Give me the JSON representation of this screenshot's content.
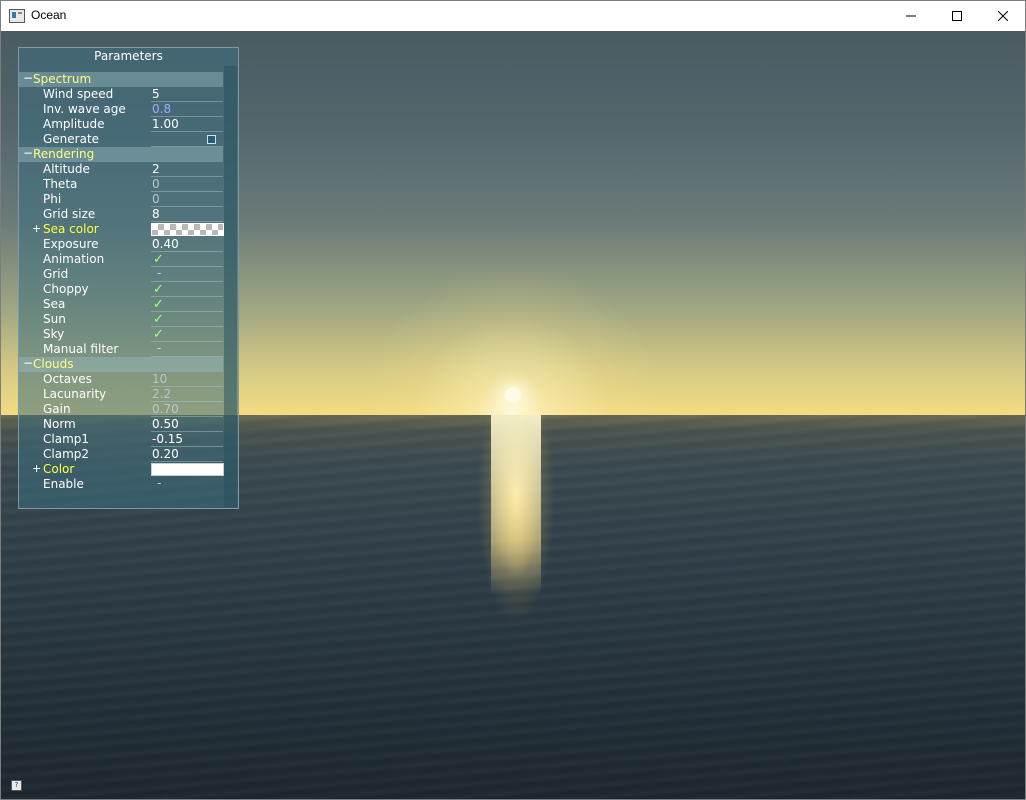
{
  "window": {
    "title": "Ocean"
  },
  "panel": {
    "title": "Parameters",
    "groups": {
      "spectrum": {
        "label": "Spectrum",
        "toggle": "−"
      },
      "rendering": {
        "label": "Rendering",
        "toggle": "−"
      },
      "clouds": {
        "label": "Clouds",
        "toggle": "−"
      }
    },
    "expand_symbol": "+",
    "checkmark": "✓",
    "unchecked": "-",
    "rows": {
      "wind_speed": {
        "label": "Wind speed",
        "value": "5"
      },
      "inv_wave_age": {
        "label": "Inv. wave age",
        "value": "0.8"
      },
      "amplitude": {
        "label": "Amplitude",
        "value": "1.00"
      },
      "generate": {
        "label": "Generate"
      },
      "altitude": {
        "label": "Altitude",
        "value": "2"
      },
      "theta": {
        "label": "Theta",
        "value": "0"
      },
      "phi": {
        "label": "Phi",
        "value": "0"
      },
      "grid_size": {
        "label": "Grid size",
        "value": "8"
      },
      "sea_color": {
        "label": "Sea color"
      },
      "exposure": {
        "label": "Exposure",
        "value": "0.40"
      },
      "animation": {
        "label": "Animation",
        "checked": true
      },
      "grid": {
        "label": "Grid",
        "checked": false
      },
      "choppy": {
        "label": "Choppy",
        "checked": true
      },
      "sea": {
        "label": "Sea",
        "checked": true
      },
      "sun": {
        "label": "Sun",
        "checked": true
      },
      "sky": {
        "label": "Sky",
        "checked": true
      },
      "manual_filter": {
        "label": "Manual filter",
        "checked": false
      },
      "octaves": {
        "label": "Octaves",
        "value": "10"
      },
      "lacunarity": {
        "label": "Lacunarity",
        "value": "2.2"
      },
      "gain": {
        "label": "Gain",
        "value": "0.70"
      },
      "norm": {
        "label": "Norm",
        "value": "0.50"
      },
      "clamp1": {
        "label": "Clamp1",
        "value": "-0.15"
      },
      "clamp2": {
        "label": "Clamp2",
        "value": "0.20"
      },
      "color": {
        "label": "Color"
      },
      "enable": {
        "label": "Enable",
        "checked": false
      }
    }
  },
  "colors": {
    "group_label": "#ffff80",
    "color_label": "#ffff40",
    "check": "#a6ff7a",
    "purple_value": "#a6a6ff"
  },
  "icons": {
    "app": "app-window-icon",
    "minimize": "minimize-icon",
    "maximize": "maximize-icon",
    "close": "close-icon",
    "corner": "help-icon"
  }
}
